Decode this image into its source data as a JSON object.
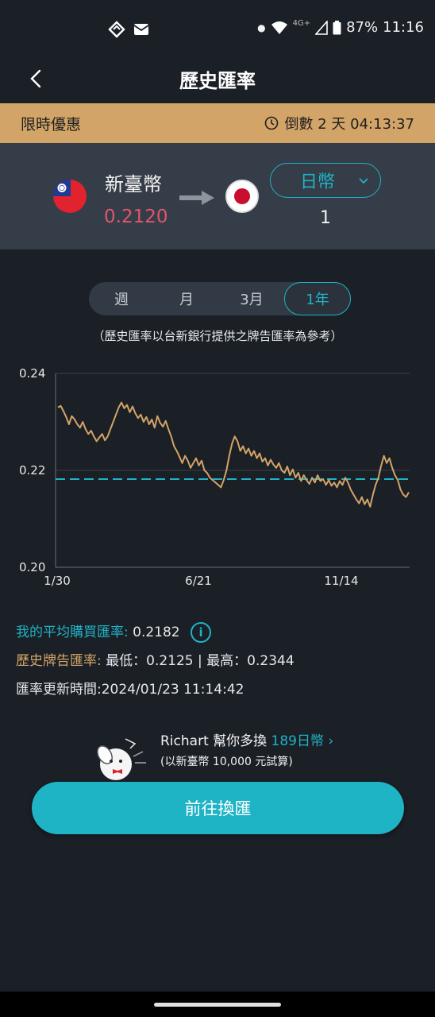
{
  "status_bar": {
    "time": "11:16",
    "battery": "87%",
    "network": "4G+",
    "icons": [
      "sync-icon",
      "mail-icon",
      "dot-icon",
      "wifi-icon",
      "signal-icon",
      "battery-icon"
    ]
  },
  "header": {
    "title": "歷史匯率",
    "back_icon": "chevron-left-icon"
  },
  "promo": {
    "label": "限時優惠",
    "countdown": "倒數 2 天 04:13:37",
    "icon": "clock-icon"
  },
  "converter": {
    "from_currency": "新臺幣",
    "from_value": "0.2120",
    "to_currency": "日幣",
    "to_value": "1",
    "from_flag": "taiwan-flag",
    "to_flag": "japan-flag",
    "colors": {
      "from_value": "#e0566b",
      "accent": "#1fb3c6"
    }
  },
  "periods": {
    "items": [
      "週",
      "月",
      "3月",
      "1年"
    ],
    "selected": "1年"
  },
  "note": "（歷史匯率以台新銀行提供之牌告匯率為參考）",
  "chart_data": {
    "type": "line",
    "x_ticks": [
      "1/30",
      "6/21",
      "11/14"
    ],
    "y_ticks": [
      "0.24",
      "0.22",
      "0.20"
    ],
    "ylim": [
      0.2,
      0.24
    ],
    "grid": true,
    "reference_line": {
      "value": 0.2182,
      "style": "dashed",
      "color": "#1fb3c6"
    },
    "line_color": "#d3a468",
    "series": [
      {
        "values": [
          0.233,
          0.2333,
          0.2322,
          0.231,
          0.2295,
          0.2312,
          0.2305,
          0.2295,
          0.2288,
          0.23,
          0.2285,
          0.2275,
          0.2282,
          0.227,
          0.226,
          0.2268,
          0.2275,
          0.2262,
          0.227,
          0.2285,
          0.23,
          0.2315,
          0.233,
          0.234,
          0.2328,
          0.2335,
          0.232,
          0.2332,
          0.2318,
          0.2308,
          0.2315,
          0.23,
          0.231,
          0.2295,
          0.2305,
          0.2288,
          0.2312,
          0.2298,
          0.229,
          0.2302,
          0.2285,
          0.227,
          0.225,
          0.224,
          0.2228,
          0.2215,
          0.223,
          0.222,
          0.2205,
          0.2215,
          0.2225,
          0.221,
          0.222,
          0.22,
          0.2195,
          0.2185,
          0.218,
          0.2175,
          0.217,
          0.2165,
          0.218,
          0.22,
          0.223,
          0.2255,
          0.227,
          0.226,
          0.224,
          0.225,
          0.2235,
          0.2245,
          0.223,
          0.224,
          0.2225,
          0.2235,
          0.2218,
          0.2225,
          0.221,
          0.2222,
          0.2212,
          0.2205,
          0.2215,
          0.22,
          0.2195,
          0.2208,
          0.219,
          0.2202,
          0.2185,
          0.2195,
          0.2178,
          0.219,
          0.218,
          0.2172,
          0.2185,
          0.2175,
          0.219,
          0.2178,
          0.2182,
          0.217,
          0.218,
          0.2168,
          0.2175,
          0.2165,
          0.2178,
          0.217,
          0.2185,
          0.2175,
          0.216,
          0.215,
          0.214,
          0.2132,
          0.2145,
          0.213,
          0.214,
          0.2125,
          0.215,
          0.217,
          0.2185,
          0.221,
          0.223,
          0.2215,
          0.2225,
          0.2205,
          0.219,
          0.218,
          0.216,
          0.215,
          0.2145,
          0.2155
        ]
      }
    ]
  },
  "stats": {
    "avg_label": "我的平均購買匯率:",
    "avg_value": "0.2182",
    "info_icon": "info-icon",
    "range_label": "歷史牌告匯率:",
    "range_value": "最低：0.2125 | 最高：0.2344",
    "updated": "匯率更新時間:2024/01/23 11:14:42"
  },
  "richart_promo": {
    "prefix": "Richart 幫你多換",
    "amount": "189日幣",
    "sub": "(以新臺幣 10,000 元試算)",
    "mascot": "dog-mascot-icon"
  },
  "cta": {
    "label": "前往換匯"
  }
}
